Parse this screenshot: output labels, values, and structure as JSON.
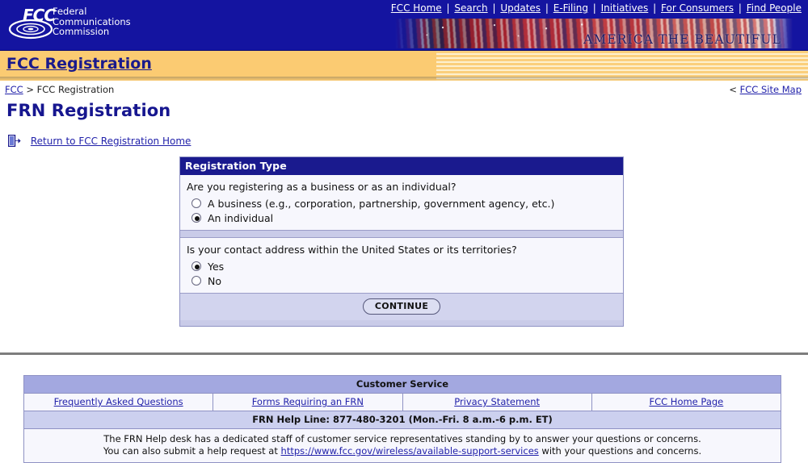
{
  "header": {
    "agency_abbr": "FCC",
    "agency_name_lines": [
      "Federal",
      "Communications",
      "Commission"
    ],
    "banner_text": "AMERICA THE BEAUTIFUL",
    "nav": [
      {
        "label": "FCC Home"
      },
      {
        "label": "Search"
      },
      {
        "label": "Updates"
      },
      {
        "label": "E-Filing"
      },
      {
        "label": "Initiatives"
      },
      {
        "label": "For Consumers"
      },
      {
        "label": "Find People"
      }
    ],
    "nav_separator": "|",
    "section_banner": "FCC Registration"
  },
  "breadcrumb": {
    "root": "FCC",
    "separator": ">",
    "current": "FCC Registration",
    "sitemap_arrow": "<",
    "sitemap_label": "FCC Site Map"
  },
  "page": {
    "title": "FRN Registration",
    "return_link": "Return to FCC Registration Home",
    "return_icon": "exit-door-icon"
  },
  "panel": {
    "heading": "Registration Type",
    "question1": "Are you registering as a business or as an individual?",
    "question1_options": [
      {
        "label": "A business (e.g., corporation, partnership, government agency, etc.)",
        "selected": false
      },
      {
        "label": "An individual",
        "selected": true
      }
    ],
    "question2": "Is your contact address within the United States or its territories?",
    "question2_options": [
      {
        "label": "Yes",
        "selected": true
      },
      {
        "label": "No",
        "selected": false
      }
    ],
    "continue_label": "CONTINUE"
  },
  "footer": {
    "title": "Customer Service",
    "links": [
      {
        "label": "Frequently Asked Questions"
      },
      {
        "label": "Forms Requiring an FRN"
      },
      {
        "label": "Privacy Statement"
      },
      {
        "label": "FCC Home Page"
      }
    ],
    "help_line": "FRN Help Line: 877-480-3201 (Mon.-Fri. 8 a.m.-6 p.m. ET)",
    "body_line1": "The FRN Help desk has a dedicated staff of customer service representatives standing by to answer your questions or concerns.",
    "body_line2_pre": "You can also submit a help request at ",
    "body_line2_link": "https://www.fcc.gov/wireless/available-support-services",
    "body_line2_post": " with your questions and concerns."
  },
  "colors": {
    "header_blue": "#1414a0",
    "banner_yellow": "#fbcb72",
    "title_blue": "#16168f",
    "panel_head_blue": "#1a1a8e",
    "link_blue": "#2222aa",
    "footer_header_lavender": "#a3a8e0"
  }
}
